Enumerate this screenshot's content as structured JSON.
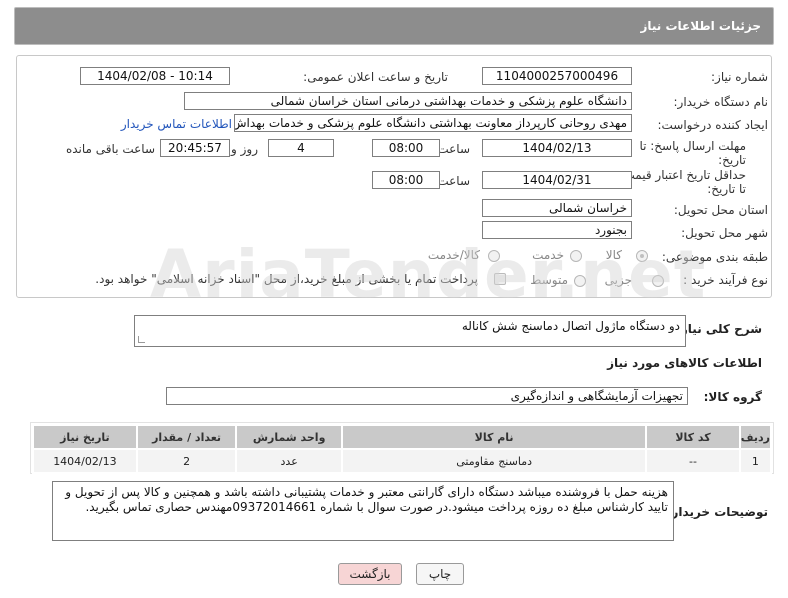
{
  "header": {
    "title": "جزئیات اطلاعات نیاز"
  },
  "form": {
    "need_number": {
      "label": "شماره نیاز:",
      "value": "1104000257000496"
    },
    "announce_datetime": {
      "label": "تاریخ و ساعت اعلان عمومی:",
      "value": "1404/02/08 - 10:14"
    },
    "buyer_org": {
      "label": "نام دستگاه خریدار:",
      "value": "دانشگاه علوم پزشکی و خدمات بهداشتی درمانی استان خراسان شمالی"
    },
    "requester": {
      "label": "ایجاد کننده درخواست:",
      "value": "مهدی روحانی کارپرداز معاونت بهداشتی دانشگاه علوم پزشکی و خدمات بهداش",
      "contact_link": "اطلاعات تماس خریدار"
    },
    "reply_deadline": {
      "label": "مهلت ارسال پاسخ: تا تاریخ:",
      "date": "1404/02/13",
      "time_label": "ساعت",
      "time": "08:00",
      "days": "4",
      "days_label": "روز و",
      "remaining": "20:45:57",
      "remaining_label": "ساعت باقی مانده"
    },
    "price_validity": {
      "label": "حداقل تاریخ اعتبار قیمت: تا تاریخ:",
      "date": "1404/02/31",
      "time_label": "ساعت",
      "time": "08:00"
    },
    "delivery_province": {
      "label": "استان محل تحویل:",
      "value": "خراسان شمالی"
    },
    "delivery_city": {
      "label": "شهر محل تحویل:",
      "value": "بجنورد"
    },
    "category": {
      "label": "طبقه بندی موضوعی:",
      "options": [
        "کالا",
        "خدمت",
        "کالا/خدمت"
      ],
      "selected": "کالا"
    },
    "purchase_type": {
      "label": "نوع فرآیند خرید :",
      "options": [
        "جزیی",
        "متوسط"
      ],
      "payment_note": "پرداخت تمام یا بخشی از مبلغ خرید،از محل \"اسناد خزانه اسلامی\" خواهد بود."
    }
  },
  "description": {
    "label": "شرح کلی نیاز:",
    "value": "دو دستگاه ماژول اتصال دماسنج شش کاناله"
  },
  "goods": {
    "section_title": "اطلاعات کالاهای مورد نیاز",
    "group_label": "گروه کالا:",
    "group_value": "تجهیزات آزمایشگاهی و اندازه‌گیری",
    "columns": [
      "ردیف",
      "کد کالا",
      "نام کالا",
      "واحد شمارش",
      "تعداد / مقدار",
      "تاریخ نیاز"
    ],
    "rows": [
      {
        "row": "1",
        "code": "--",
        "name": "دماسنج مقاومتی",
        "unit": "عدد",
        "qty": "2",
        "date": "1404/02/13"
      }
    ]
  },
  "buyer_notes": {
    "label": "توضیحات خریدار:",
    "value": "هزینه حمل با فروشنده میباشد دستگاه دارای گارانتی معتبر و خدمات پشتیبانی داشته باشد و همچنین و کالا پس از تحویل و تایید کارشناس مبلغ ده روزه پرداخت میشود.در صورت سوال با شماره 09372014661مهندس حصاری تماس بگیرید."
  },
  "buttons": {
    "print": "چاپ",
    "back": "بازگشت"
  },
  "watermark": "AriaTender.net"
}
